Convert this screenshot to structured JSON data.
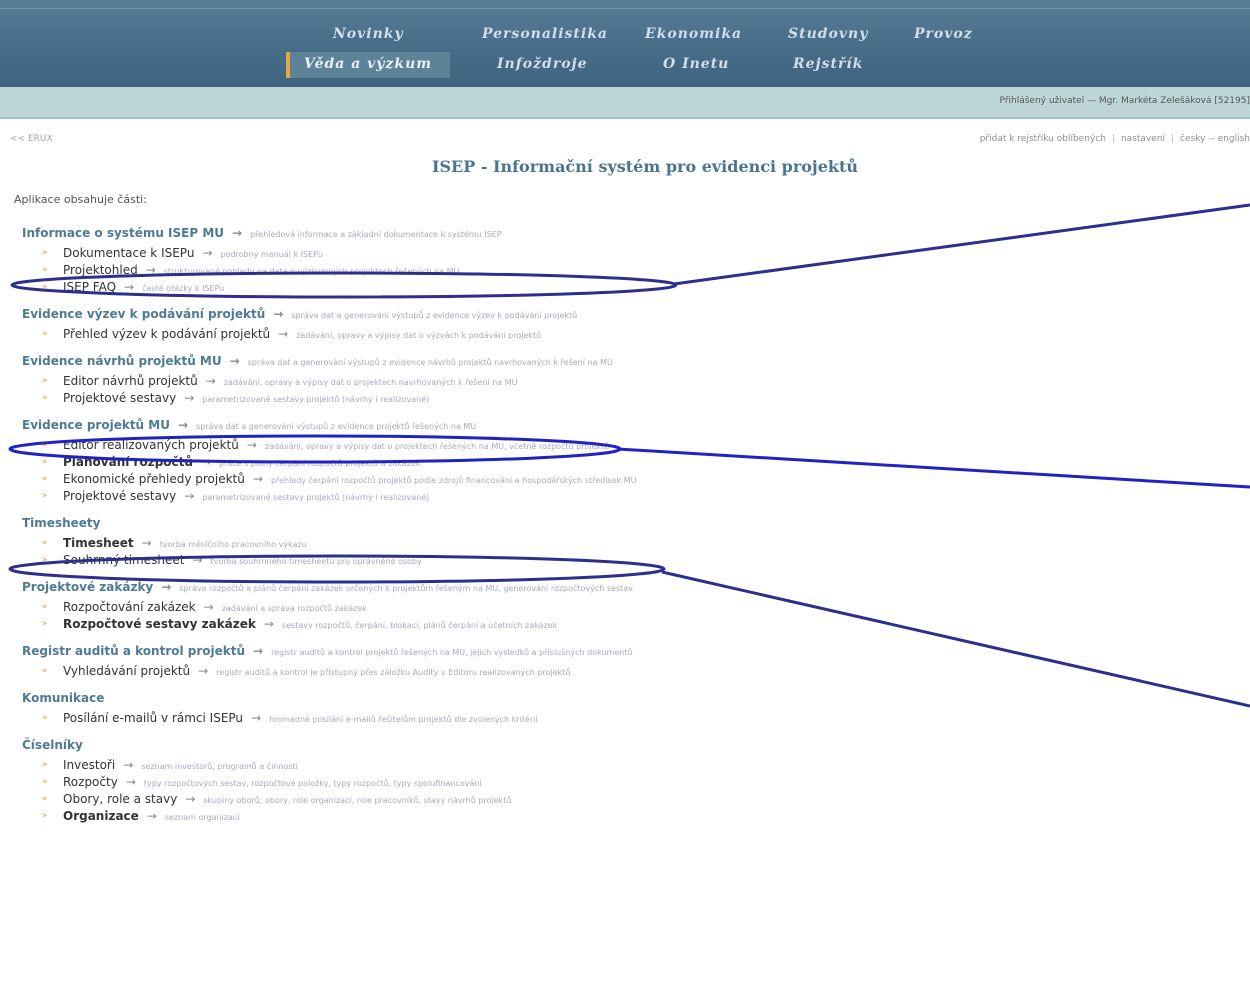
{
  "nav": {
    "row1": [
      "Novinky",
      "Personalistika",
      "Ekonomika",
      "Studovny",
      "Provoz"
    ],
    "row2": [
      "Věda a výzkum",
      "Infoždroje",
      "O Inetu",
      "Rejstřík"
    ]
  },
  "user": {
    "text": "Přihlášený uživatel — Mgr. Markéta Zelešáková [52195]"
  },
  "back": "<< ERUX",
  "right_links": [
    "přidat k rejstříku oblíbených",
    "nastavení",
    "česky -- english"
  ],
  "title": "ISEP - Informační systém pro evidenci projektů",
  "intro": "Aplikace obsahuje části:",
  "sections": [
    {
      "title": "Informace o systému ISEP MU",
      "desc": "přehledová informace a základní dokumentace k systému ISEP",
      "items": [
        {
          "label": "Dokumentace k ISEPu",
          "desc": "podrobný manuál k ISEPu",
          "bold": false
        },
        {
          "label": "Projektohled",
          "desc": "strukturované pohledy na data o výzkumných projektech řešených na MU",
          "bold": false
        },
        {
          "label": "ISEP FAQ",
          "desc": "časté otázky k ISEPu",
          "bold": false
        }
      ]
    },
    {
      "title": "Evidence výzev k podávání projektů",
      "desc": "správa dat a generování výstupů z evidence výzev k podávání projektů",
      "items": [
        {
          "label": "Přehled výzev k podávání projektů",
          "desc": "zadávání, opravy a výpisy dat o výzvách k podávání projektů",
          "bold": false
        }
      ]
    },
    {
      "title": "Evidence návrhů projektů MU",
      "desc": "správa dat a generování výstupů z evidence návrhů projektů navrhovaných k řešení na MU",
      "items": [
        {
          "label": "Editor návrhů projektů",
          "desc": "zadávání, opravy a výpisy dat o projektech navrhovaných k řešení na MU",
          "bold": false
        },
        {
          "label": "Projektové sestavy",
          "desc": "parametrizované sestavy projektů (návrhy i realizované)",
          "bold": false
        }
      ]
    },
    {
      "title": "Evidence projektů MU",
      "desc": "správa dat a generování výstupů z evidence projektů řešených na MU",
      "items": [
        {
          "label": "Editor realizovaných projektů",
          "desc": "zadávání, opravy a výpisy dat o projektech řešených na MU, včetně rozpočtů projektů",
          "bold": false
        },
        {
          "label": "Plánování rozpočtů",
          "desc": "práce s plány čerpání rozpočtů projektů a zakázek",
          "bold": true
        },
        {
          "label": "Ekonomické přehledy projektů",
          "desc": "přehledy čerpání rozpočtů projektů podle zdrojů financování a hospodářských středisek MU",
          "bold": false
        },
        {
          "label": "Projektové sestavy",
          "desc": "parametrizované sestavy projektů (návrhy i realizované)",
          "bold": false
        }
      ]
    },
    {
      "title": "Timesheety",
      "desc": "",
      "items": [
        {
          "label": "Timesheet",
          "desc": "tvorba měsíčního pracovního výkazu",
          "bold": true
        },
        {
          "label": "Souhrnný timesheet",
          "desc": "tvorba souhrnného timesheetu pro oprávněné osoby",
          "bold": false
        }
      ]
    },
    {
      "title": "Projektové zakázky",
      "desc": "správa rozpočtů a plánů čerpání zakázek určených k projektům řešeným na MU, generování rozpočtových sestav",
      "items": [
        {
          "label": "Rozpočtování zakázek",
          "desc": "zadávání a správa rozpočtů zakázek",
          "bold": false
        },
        {
          "label": "Rozpočtové sestavy zakázek",
          "desc": "sestavy rozpočtů, čerpání, blokací, plánů čerpání a účetních zakázek",
          "bold": true
        }
      ]
    },
    {
      "title": "Registr auditů a kontrol projektů",
      "desc": "registr auditů a kontrol projektů řešených na MU, jejich výsledků a příslušných dokumentů",
      "items": [
        {
          "label": "Vyhledávání projektů",
          "desc": "registr auditů a kontrol je přístupný přes záložku Audity v Editoru realizovaných projektů",
          "bold": false
        }
      ]
    },
    {
      "title": "Komunikace",
      "desc": "",
      "items": [
        {
          "label": "Posílání e-mailů v rámci ISEPu",
          "desc": "hromadné posílání e-mailů řešitelům projektů dle zvolených kritérií",
          "bold": false
        }
      ]
    },
    {
      "title": "Číselníky",
      "desc": "",
      "items": [
        {
          "label": "Investoři",
          "desc": "seznam investorů, programů a činností",
          "bold": false
        },
        {
          "label": "Rozpočty",
          "desc": "typy rozpočtových sestav, rozpočtové položky, typy rozpočtů, typy spolufinancování",
          "bold": false
        },
        {
          "label": "Obory, role a stavy",
          "desc": "skupiny oborů, obory, role organizací, role pracovníků, stavy návrhů projektů",
          "bold": false
        },
        {
          "label": "Organizace",
          "desc": "seznam organizací",
          "bold": true
        }
      ]
    }
  ],
  "colors": {
    "nav_bg": "#4a6f8a",
    "user_bar": "#bfd6d9",
    "section": "#4e7a95",
    "annotation": "#2c2f8c",
    "bullet": "#e2a24a"
  }
}
